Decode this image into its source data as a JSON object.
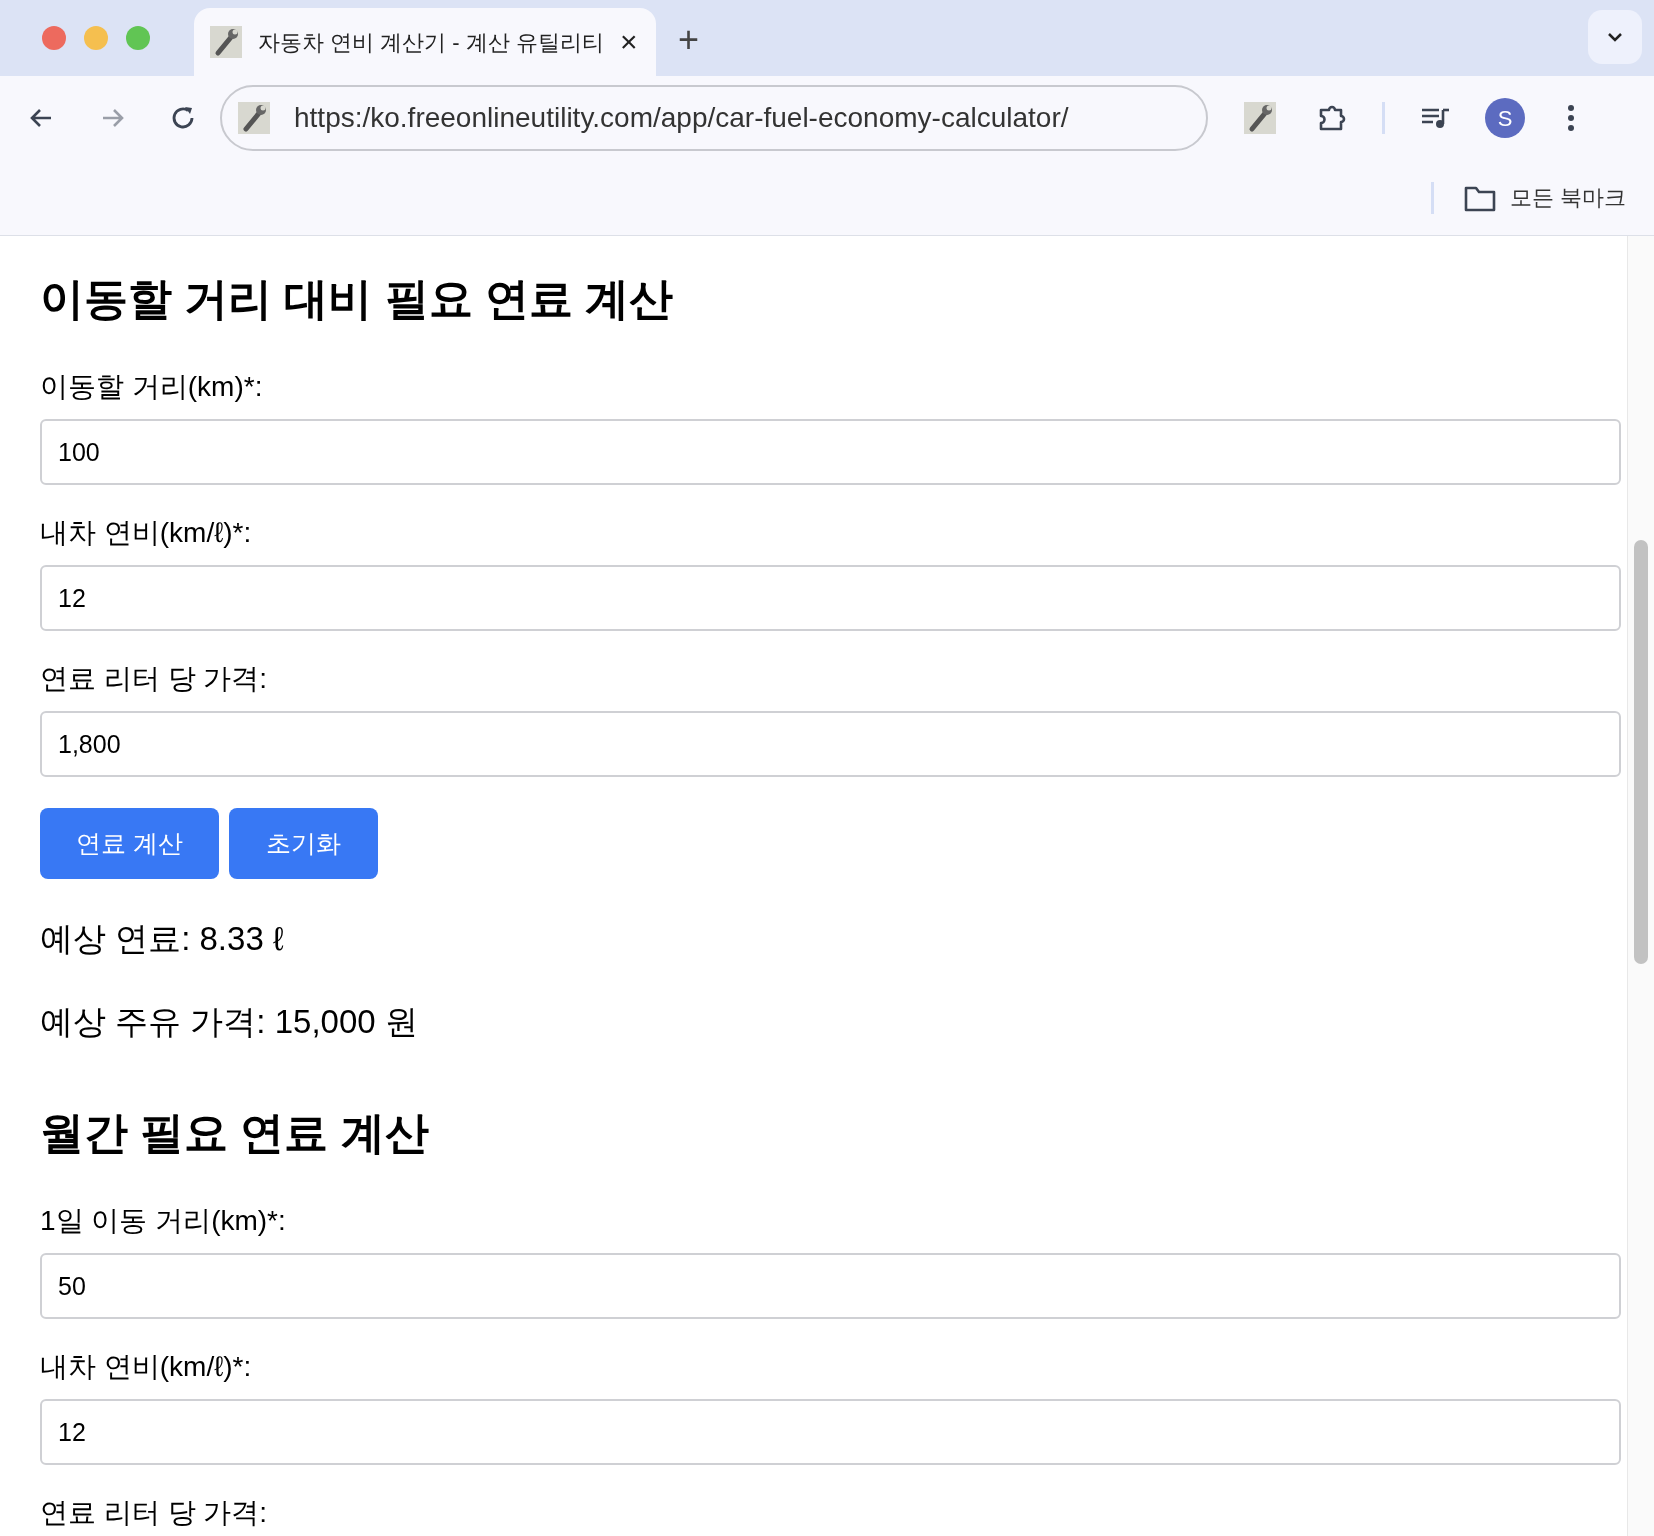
{
  "browser": {
    "tab": {
      "title": "자동차 연비 계산기 - 계산 유틸리티",
      "selected": true
    },
    "new_tab": "+",
    "close_tab": "×",
    "url": "https:/ko.freeonlineutility.com/app/car-fuel-economy-calculator/",
    "profile_initial": "S",
    "bookmarks_label": "모든 북마크"
  },
  "sections": [
    {
      "heading": "이동할 거리 대비 필요 연료 계산",
      "fields": [
        {
          "label": "이동할 거리(km)*:",
          "value": "100"
        },
        {
          "label": "내차 연비(km/ℓ)*:",
          "value": "12"
        },
        {
          "label": "연료 리터 당 가격:",
          "value": "1,800"
        }
      ],
      "buttons": [
        "연료 계산",
        "초기화"
      ],
      "results": [
        "예상 연료: 8.33 ℓ",
        "예상 주유 가격: 15,000 원"
      ]
    },
    {
      "heading": "월간 필요 연료 계산",
      "fields": [
        {
          "label": "1일 이동 거리(km)*:",
          "value": "50"
        },
        {
          "label": "내차 연비(km/ℓ)*:",
          "value": "12"
        },
        {
          "label": "연료 리터 당 가격:"
        }
      ]
    }
  ]
}
